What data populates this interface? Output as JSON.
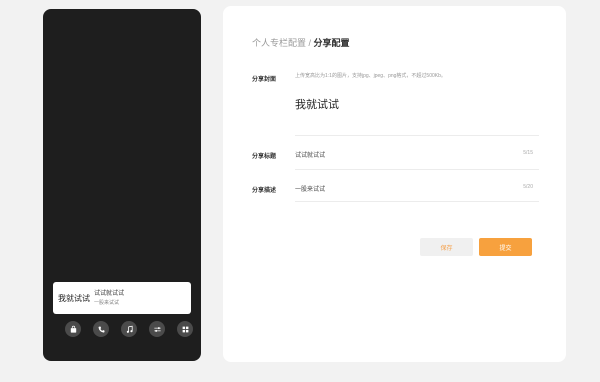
{
  "preview": {
    "card": {
      "cover_text": "我就试试",
      "title": "试试就试试",
      "desc": "一股来试试"
    },
    "icons": [
      {
        "name": "bag-icon"
      },
      {
        "name": "phone-icon"
      },
      {
        "name": "music-icon"
      },
      {
        "name": "settings-sliders-icon"
      },
      {
        "name": "grid-icon"
      }
    ]
  },
  "breadcrumb": {
    "parent": "个人专栏配置",
    "separator": " / ",
    "current": "分享配置"
  },
  "form": {
    "cover": {
      "label": "分享封面",
      "hint": "上传宽高比为1:1的图片，支持jpg、jpeg、png格式，不超过500Kb。",
      "preview_text": "我就试试"
    },
    "title": {
      "label": "分享标题",
      "value": "试试就试试",
      "count": "5/15"
    },
    "desc": {
      "label": "分享描述",
      "value": "一股来试试",
      "count": "5/20"
    }
  },
  "buttons": {
    "save": "保存",
    "submit": "提交"
  }
}
